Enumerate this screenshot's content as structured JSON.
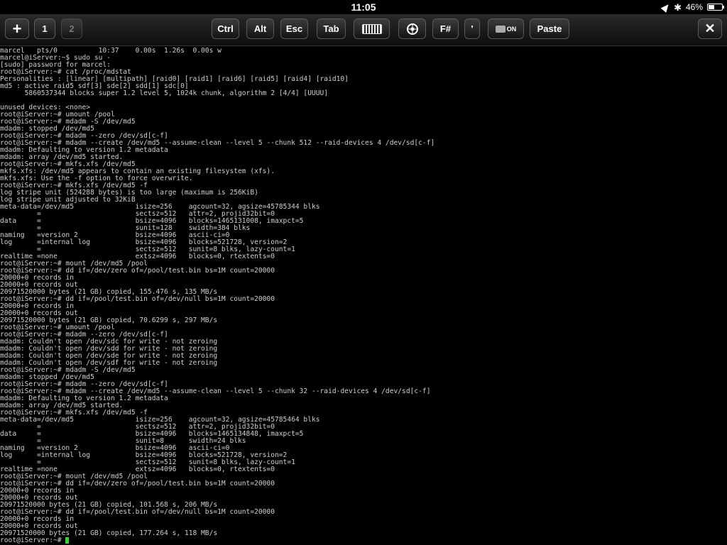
{
  "status_bar": {
    "time": "11:05",
    "battery": "46%",
    "battery_level": 0.46,
    "icons": [
      "location-arrow-icon",
      "bluetooth-icon",
      "battery-icon"
    ]
  },
  "toolbar": {
    "add_label": "+",
    "session_1": "1",
    "session_2": "2",
    "ctrl": "Ctrl",
    "alt": "Alt",
    "esc": "Esc",
    "tab": "Tab",
    "fsharp": "F#",
    "quote": "'",
    "toggle_on": "ON",
    "paste": "Paste",
    "close": "✕"
  },
  "terminal": {
    "cursor_color": "#3ad13a",
    "lines": [
      "marcel   pts/0          10:37    0.00s  1.26s  0.00s w",
      "marcel@iServer:~$ sudo su -",
      "[sudo] password for marcel:",
      "root@iServer:~# cat /proc/mdstat",
      "Personalities : [linear] [multipath] [raid0] [raid1] [raid6] [raid5] [raid4] [raid10]",
      "md5 : active raid5 sdf[3] sde[2] sdd[1] sdc[0]",
      "      5860537344 blocks super 1.2 level 5, 1024k chunk, algorithm 2 [4/4] [UUUU]",
      "",
      "unused devices: <none>",
      "root@iServer:~# umount /pool",
      "root@iServer:~# mdadm -S /dev/md5",
      "mdadm: stopped /dev/md5",
      "root@iServer:~# mdadm --zero /dev/sd[c-f]",
      "root@iServer:~# mdadm --create /dev/md5 --assume-clean --level 5 --chunk 512 --raid-devices 4 /dev/sd[c-f]",
      "mdadm: Defaulting to version 1.2 metadata",
      "mdadm: array /dev/md5 started.",
      "root@iServer:~# mkfs.xfs /dev/md5",
      "mkfs.xfs: /dev/md5 appears to contain an existing filesystem (xfs).",
      "mkfs.xfs: Use the -f option to force overwrite.",
      "root@iServer:~# mkfs.xfs /dev/md5 -f",
      "log stripe unit (524288 bytes) is too large (maximum is 256KiB)",
      "log stripe unit adjusted to 32KiB",
      "meta-data=/dev/md5               isize=256    agcount=32, agsize=45785344 blks",
      "         =                       sectsz=512   attr=2, projid32bit=0",
      "data     =                       bsize=4096   blocks=1465131008, imaxpct=5",
      "         =                       sunit=128    swidth=384 blks",
      "naming   =version 2              bsize=4096   ascii-ci=0",
      "log      =internal log           bsize=4096   blocks=521728, version=2",
      "         =                       sectsz=512   sunit=8 blks, lazy-count=1",
      "realtime =none                   extsz=4096   blocks=0, rtextents=0",
      "root@iServer:~# mount /dev/md5 /pool",
      "root@iServer:~# dd if=/dev/zero of=/pool/test.bin bs=1M count=20000",
      "20000+0 records in",
      "20000+0 records out",
      "20971520000 bytes (21 GB) copied, 155.476 s, 135 MB/s",
      "root@iServer:~# dd if=/pool/test.bin of=/dev/null bs=1M count=20000",
      "20000+0 records in",
      "20000+0 records out",
      "20971520000 bytes (21 GB) copied, 70.6299 s, 297 MB/s",
      "root@iServer:~# umount /pool",
      "root@iServer:~# mdadm --zero /dev/sd[c-f]",
      "mdadm: Couldn't open /dev/sdc for write - not zeroing",
      "mdadm: Couldn't open /dev/sdd for write - not zeroing",
      "mdadm: Couldn't open /dev/sde for write - not zeroing",
      "mdadm: Couldn't open /dev/sdf for write - not zeroing",
      "root@iServer:~# mdadm -S /dev/md5",
      "mdadm: stopped /dev/md5",
      "root@iServer:~# mdadm --zero /dev/sd[c-f]",
      "root@iServer:~# mdadm --create /dev/md5 --assume-clean --level 5 --chunk 32 --raid-devices 4 /dev/sd[c-f]",
      "mdadm: Defaulting to version 1.2 metadata",
      "mdadm: array /dev/md5 started.",
      "root@iServer:~# mkfs.xfs /dev/md5 -f",
      "meta-data=/dev/md5               isize=256    agcount=32, agsize=45785464 blks",
      "         =                       sectsz=512   attr=2, projid32bit=0",
      "data     =                       bsize=4096   blocks=1465134848, imaxpct=5",
      "         =                       sunit=8      swidth=24 blks",
      "naming   =version 2              bsize=4096   ascii-ci=0",
      "log      =internal log           bsize=4096   blocks=521728, version=2",
      "         =                       sectsz=512   sunit=8 blks, lazy-count=1",
      "realtime =none                   extsz=4096   blocks=0, rtextents=0",
      "root@iServer:~# mount /dev/md5 /pool",
      "root@iServer:~# dd if=/dev/zero of=/pool/test.bin bs=1M count=20000",
      "20000+0 records in",
      "20000+0 records out",
      "20971520000 bytes (21 GB) copied, 101.568 s, 206 MB/s",
      "root@iServer:~# dd if=/pool/test.bin of=/dev/null bs=1M count=20000",
      "20000+0 records in",
      "20000+0 records out",
      "20971520000 bytes (21 GB) copied, 177.264 s, 118 MB/s"
    ],
    "prompt": "root@iServer:~# "
  }
}
